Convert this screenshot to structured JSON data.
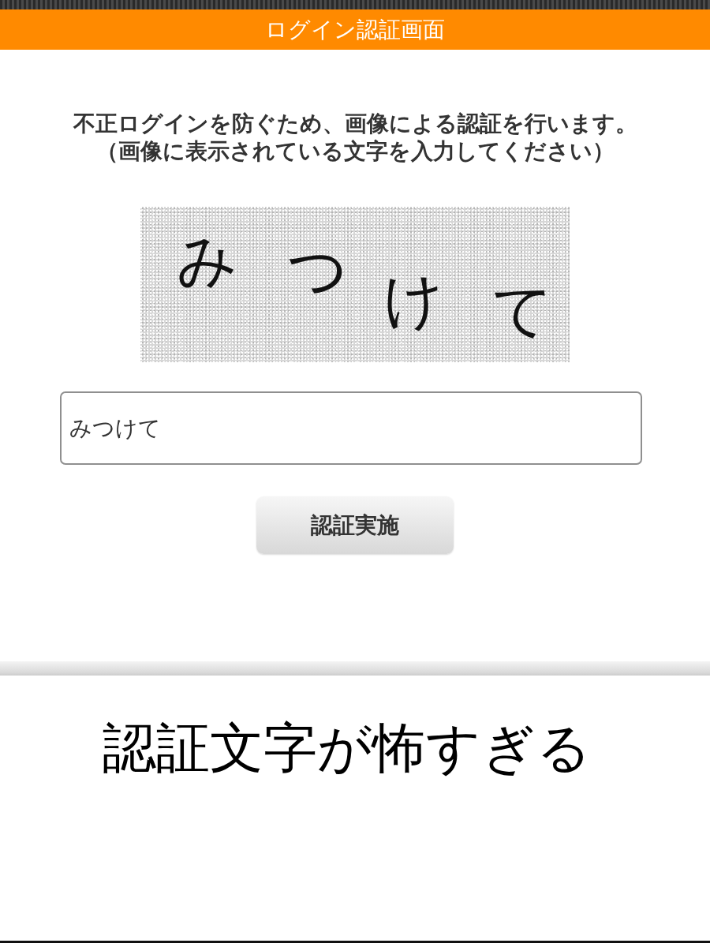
{
  "header": {
    "title": "ログイン認証画面"
  },
  "instructions": [
    "不正ログインを防ぐため、画像による認証を行います。",
    "（画像に表示されている文字を入力してください）"
  ],
  "captcha": {
    "characters": [
      "み",
      "つ",
      "け",
      "て"
    ]
  },
  "answer_field": {
    "value": "みつけて"
  },
  "submit_button": {
    "label": "認証実施"
  },
  "caption": "認証文字が怖すぎる"
}
